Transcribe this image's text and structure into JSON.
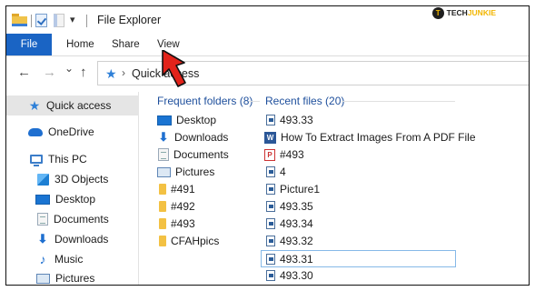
{
  "window": {
    "title": "File Explorer",
    "quick_access_toolbar": [
      "folder-icon",
      "properties-check-icon",
      "new-page-icon",
      "customize-caret-icon"
    ],
    "caret": "▾"
  },
  "brand": {
    "logo_letter": "T",
    "text_a": "TECH",
    "text_b": "JUNKIE"
  },
  "ribbon": {
    "tabs": [
      {
        "label": "File"
      },
      {
        "label": "Home"
      },
      {
        "label": "Share"
      },
      {
        "label": "View"
      }
    ],
    "file_tab_color": "#1a64c4"
  },
  "navigation": {
    "back": "←",
    "forward": "→",
    "recent": "⌄",
    "up": "↑",
    "address_icon": "★",
    "address_chevron": "›",
    "address_text": "Quick access"
  },
  "sidebar": {
    "items": [
      {
        "label": "Quick access",
        "icon": "star-icon",
        "selected": true
      },
      {
        "label": "OneDrive",
        "icon": "cloud-icon"
      },
      {
        "label": "This PC",
        "icon": "computer-icon"
      },
      {
        "label": "3D Objects",
        "icon": "cube-icon"
      },
      {
        "label": "Desktop",
        "icon": "desktop-icon"
      },
      {
        "label": "Documents",
        "icon": "documents-icon"
      },
      {
        "label": "Downloads",
        "icon": "download-icon"
      },
      {
        "label": "Music",
        "icon": "music-icon"
      },
      {
        "label": "Pictures",
        "icon": "pictures-icon"
      }
    ],
    "star_glyph": "★",
    "download_glyph": "⬇",
    "music_glyph": "♪"
  },
  "frequent": {
    "heading": "Frequent folders (8)",
    "items": [
      {
        "label": "Desktop",
        "icon": "desktop-icon"
      },
      {
        "label": "Downloads",
        "icon": "download-icon"
      },
      {
        "label": "Documents",
        "icon": "documents-icon"
      },
      {
        "label": "Pictures",
        "icon": "pictures-icon"
      },
      {
        "label": "#491",
        "icon": "folder-icon"
      },
      {
        "label": "#492",
        "icon": "folder-icon"
      },
      {
        "label": "#493",
        "icon": "folder-icon"
      },
      {
        "label": "CFAHpics",
        "icon": "folder-icon"
      }
    ]
  },
  "recent": {
    "heading": "Recent files (20)",
    "items": [
      {
        "label": "493.33",
        "icon": "image-file-icon"
      },
      {
        "label": "How To Extract Images From A PDF File",
        "icon": "word-file-icon"
      },
      {
        "label": "#493",
        "icon": "pdf-file-icon"
      },
      {
        "label": "4",
        "icon": "image-file-icon"
      },
      {
        "label": "Picture1",
        "icon": "image-file-icon"
      },
      {
        "label": "493.35",
        "icon": "image-file-icon"
      },
      {
        "label": "493.34",
        "icon": "image-file-icon"
      },
      {
        "label": "493.32",
        "icon": "image-file-icon"
      },
      {
        "label": "493.31",
        "icon": "image-file-icon",
        "highlighted": true
      },
      {
        "label": "493.30",
        "icon": "image-file-icon"
      }
    ],
    "word_letter": "W",
    "pdf_letter": "P"
  },
  "colors": {
    "accent": "#1a64c4",
    "group_heading": "#1e4f9c",
    "pointer_arrow": "#e2231a",
    "folder": "#f3c143"
  }
}
